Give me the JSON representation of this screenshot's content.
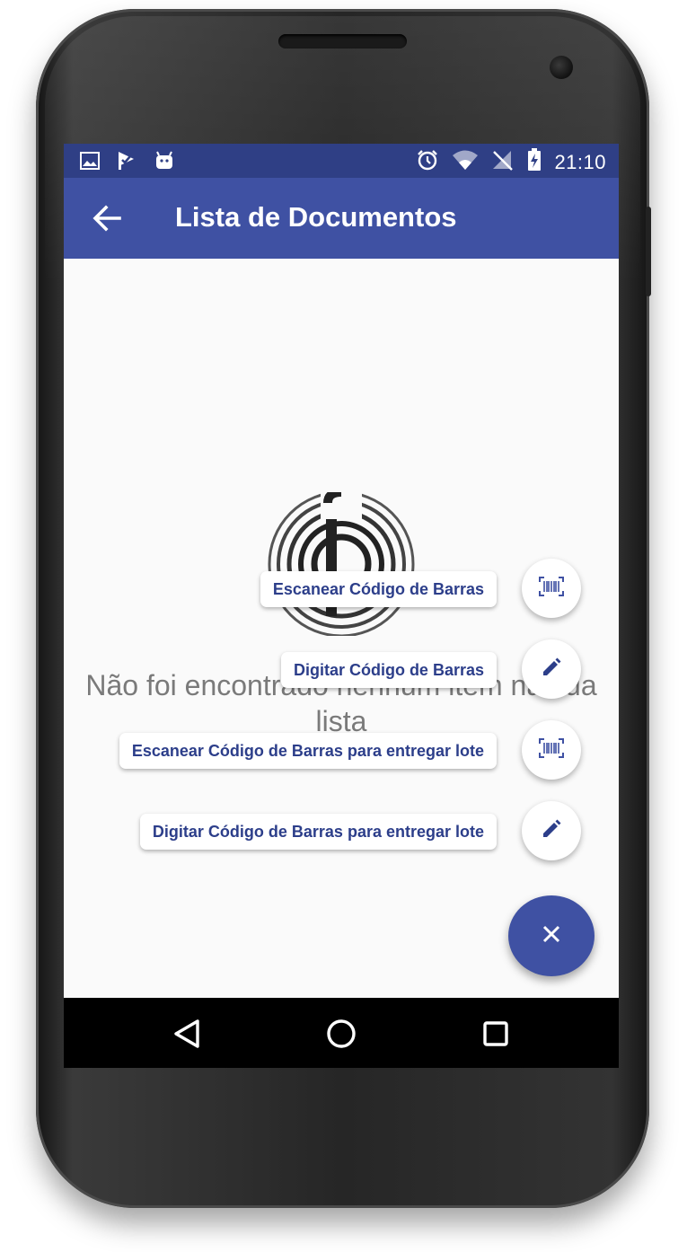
{
  "status_bar": {
    "time": "21:10",
    "left_icons": [
      "image-icon",
      "check-flag-icon",
      "android-icon"
    ],
    "right_icons": [
      "alarm-icon",
      "wifi-icon",
      "no-signal-icon",
      "battery-charging-icon"
    ]
  },
  "app_bar": {
    "title": "Lista de Documentos",
    "back_icon": "arrow-back-icon"
  },
  "empty_state": {
    "message": "Não foi encontrado nenhum item na sua lista"
  },
  "fab_menu": {
    "actions": [
      {
        "label": "Escanear Código de Barras",
        "icon": "barcode-scan-icon"
      },
      {
        "label": "Digitar Código de Barras",
        "icon": "pencil-icon"
      },
      {
        "label": "Escanear Código de Barras para entregar lote",
        "icon": "barcode-scan-icon"
      },
      {
        "label": "Digitar Código de Barras para entregar lote",
        "icon": "pencil-icon"
      }
    ],
    "close_icon": "close-icon"
  },
  "nav_bar": {
    "icons": [
      "nav-back-icon",
      "nav-home-icon",
      "nav-recents-icon"
    ]
  },
  "colors": {
    "primary": "#3f51a3",
    "primary_dark": "#2f3f85",
    "label_text": "#2c3e8a",
    "background": "#fafafa"
  }
}
